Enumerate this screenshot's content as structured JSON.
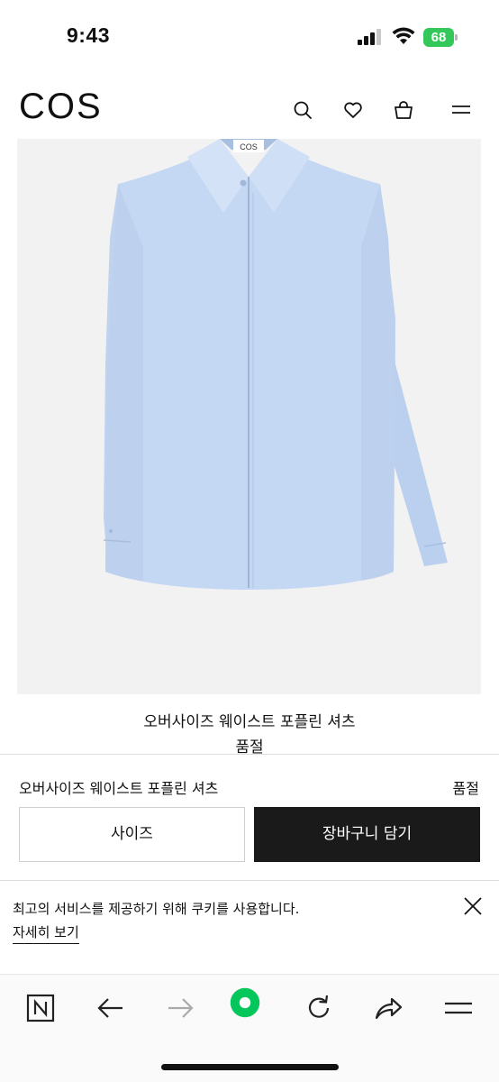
{
  "status_bar": {
    "time": "9:43",
    "battery": "68",
    "icons": [
      "signal-icon",
      "wifi-icon",
      "battery-icon"
    ]
  },
  "header": {
    "logo": "COS",
    "icons": [
      "search-icon",
      "heart-icon",
      "bag-icon",
      "menu-icon"
    ]
  },
  "product": {
    "image_alt": "light blue oversized shirt",
    "label_brand": "COS",
    "name": "오버사이즈 웨이스트 포플린 셔츠",
    "status": "품절"
  },
  "purchase_bar": {
    "name": "오버사이즈 웨이스트 포플린 셔츠",
    "status": "품절",
    "size_label": "사이즈",
    "cart_label": "장바구니 담기"
  },
  "cookie": {
    "text": "최고의 서비스를 제공하기 위해 쿠키를 사용합니다.",
    "link": "자세히 보기",
    "close_icon": "close-icon"
  },
  "toolbar": {
    "icons": [
      "naver-n-icon",
      "back-arrow-icon",
      "forward-arrow-icon",
      "green-dot-icon",
      "reload-icon",
      "share-icon",
      "menu-icon"
    ]
  },
  "colors": {
    "shirt": "#c5d8f3",
    "cart_button": "#1a1a1a",
    "battery": "#34c759",
    "green_button": "#03c75a"
  }
}
